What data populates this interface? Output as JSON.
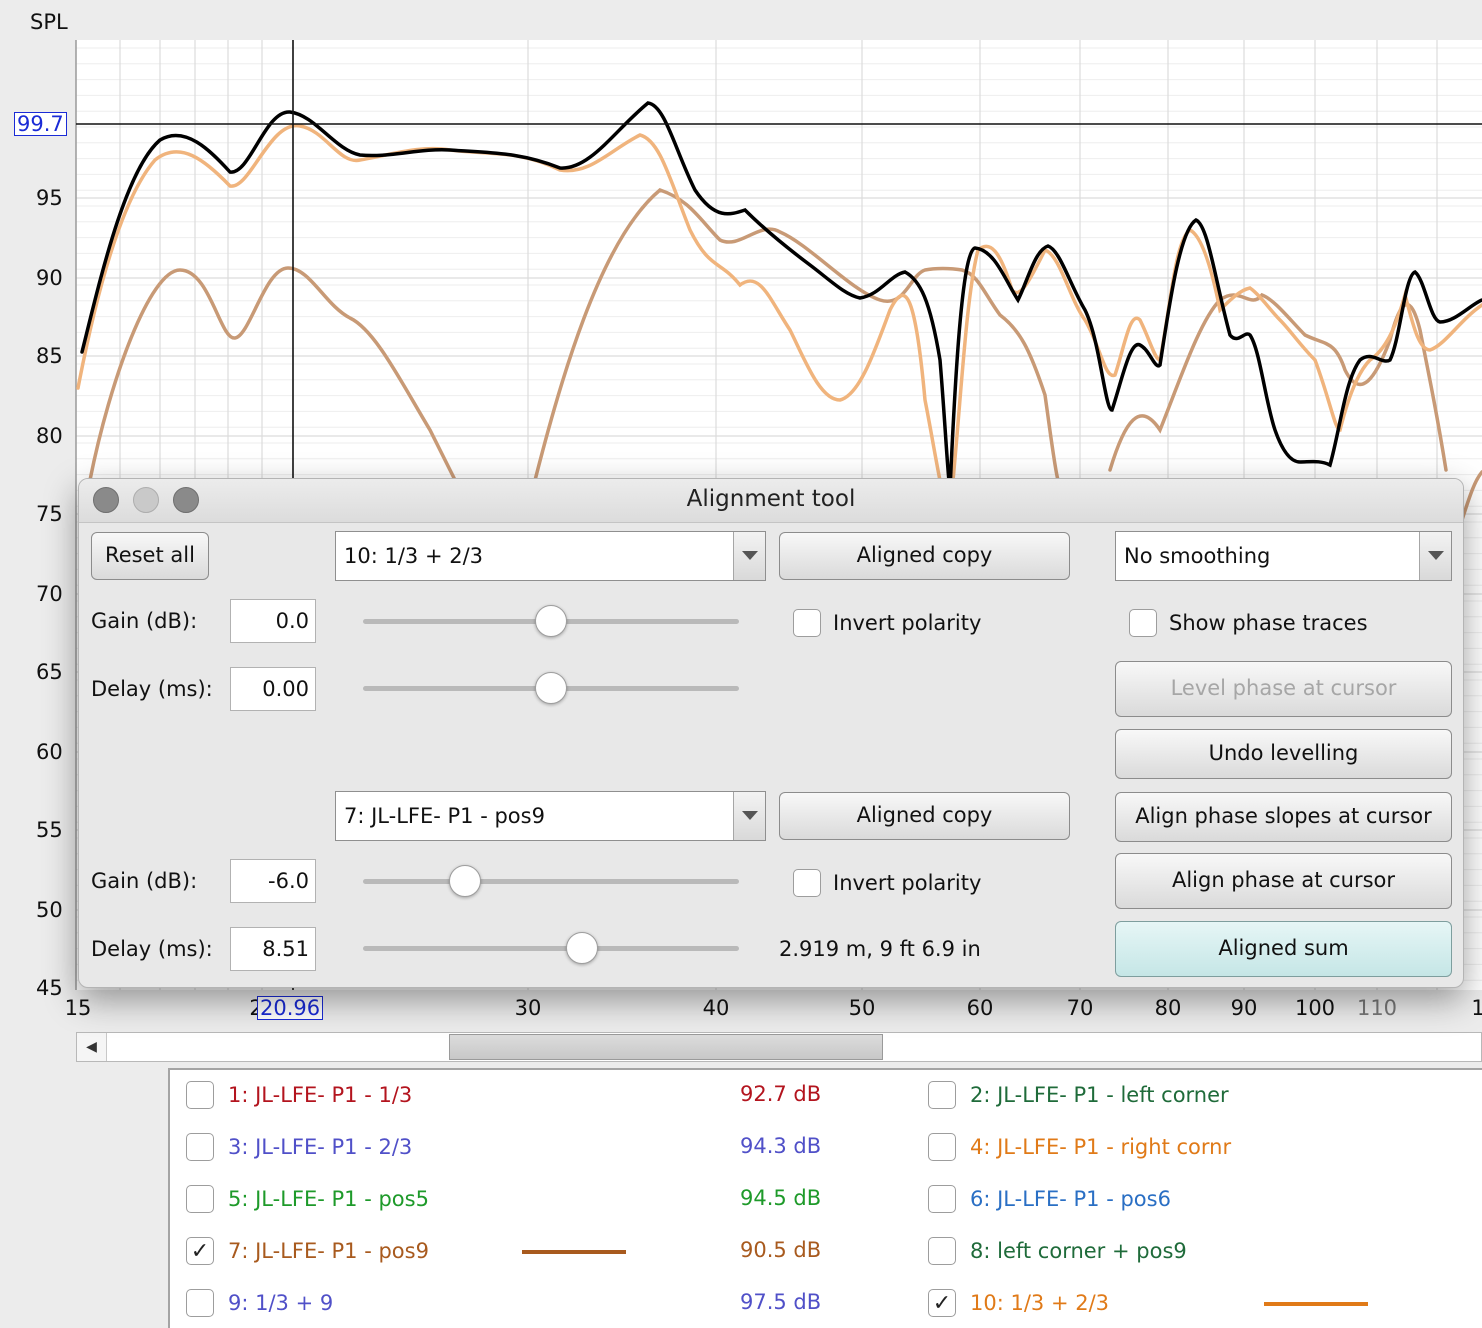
{
  "graph": {
    "y_title": "SPL",
    "y_ticks": [
      "95",
      "90",
      "85",
      "80",
      "75",
      "70",
      "65",
      "60",
      "55",
      "50",
      "45"
    ],
    "x_ticks": [
      "15",
      "30",
      "40",
      "50",
      "60",
      "70",
      "80",
      "90",
      "100",
      "110",
      "1"
    ],
    "x_tick_first_partial": "2",
    "cursor_x": "20.96",
    "cursor_y": "99.7",
    "colors": {
      "sum": "#000000",
      "trace10": "#f0b47d",
      "trace7": "#c89a76",
      "grid": "#dcdcdc"
    }
  },
  "dialog": {
    "title": "Alignment tool",
    "reset_all": "Reset all",
    "trace1": {
      "selected": "10: 1/3 + 2/3",
      "aligned_copy": "Aligned copy",
      "gain_label": "Gain (dB):",
      "gain_value": "0.0",
      "gain_slider": 0.5,
      "delay_label": "Delay (ms):",
      "delay_value": "0.00",
      "delay_slider": 0.5,
      "invert_polarity": "Invert polarity"
    },
    "trace2": {
      "selected": "7: JL-LFE- P1 - pos9",
      "aligned_copy": "Aligned copy",
      "gain_label": "Gain (dB):",
      "gain_value": "-6.0",
      "gain_slider": 0.25,
      "delay_label": "Delay (ms):",
      "delay_value": "8.51",
      "delay_slider": 0.59,
      "invert_polarity": "Invert polarity",
      "distance": "2.919 m, 9 ft 6.9 in"
    },
    "smoothing": "No  smoothing",
    "show_phase_traces": "Show phase traces",
    "level_phase": "Level phase at cursor",
    "undo_levelling": "Undo levelling",
    "align_slopes": "Align phase slopes at cursor",
    "align_phase": "Align phase at cursor",
    "aligned_sum": "Aligned sum"
  },
  "legend": {
    "items": [
      {
        "label": "1: JL-LFE- P1 - 1/3",
        "db": "92.7 dB",
        "checked": false,
        "color": "#b3141e"
      },
      {
        "label": "2: JL-LFE- P1 - left corner",
        "checked": false,
        "color": "#1f6b3a"
      },
      {
        "label": "3: JL-LFE- P1 - 2/3",
        "db": "94.3 dB",
        "checked": false,
        "color": "#5050c8"
      },
      {
        "label": "4: JL-LFE- P1 - right cornr",
        "checked": false,
        "color": "#e07a18"
      },
      {
        "label": "5: JL-LFE- P1 - pos5",
        "db": "94.5 dB",
        "checked": false,
        "color": "#1e9a2a"
      },
      {
        "label": "6: JL-LFE- P1 - pos6",
        "checked": false,
        "color": "#2a6fc4"
      },
      {
        "label": "7: JL-LFE- P1 - pos9",
        "db": "90.5 dB",
        "checked": true,
        "color": "#a85a1e"
      },
      {
        "label": "8: left corner + pos9",
        "checked": false,
        "color": "#1f6b3a"
      },
      {
        "label": "9: 1/3 + 9",
        "db": "97.5 dB",
        "checked": false,
        "color": "#5050c8"
      },
      {
        "label": "10: 1/3 + 2/3",
        "checked": true,
        "color": "#e07a18"
      }
    ],
    "check_mark": "✓"
  }
}
